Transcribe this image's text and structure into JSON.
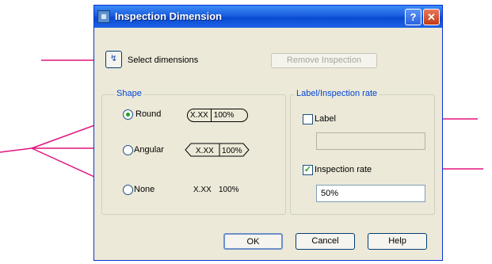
{
  "window": {
    "title": "Inspection Dimension"
  },
  "title_buttons": {
    "help": "?",
    "close": "✕"
  },
  "select": {
    "label": "Select dimensions"
  },
  "remove_button": "Remove Inspection",
  "shape": {
    "group_label": "Shape",
    "options": [
      {
        "label": "Round",
        "checked": true,
        "sample_value": "X.XX",
        "sample_rate": "100%"
      },
      {
        "label": "Angular",
        "checked": false,
        "sample_value": "X.XX",
        "sample_rate": "100%"
      },
      {
        "label": "None",
        "checked": false,
        "sample_value": "X.XX",
        "sample_rate": "100%"
      }
    ]
  },
  "label_rate": {
    "group_label": "Label/Inspection rate",
    "label_checkbox": {
      "label": "Label",
      "checked": false
    },
    "label_input": "",
    "rate_checkbox": {
      "label": "Inspection rate",
      "checked": true
    },
    "rate_input": "50%"
  },
  "buttons": {
    "ok": "OK",
    "cancel": "Cancel",
    "help": "Help"
  },
  "colors": {
    "callout": "#e0157f",
    "title_bar": "#0a4ad1",
    "group_label": "#0046d5"
  }
}
